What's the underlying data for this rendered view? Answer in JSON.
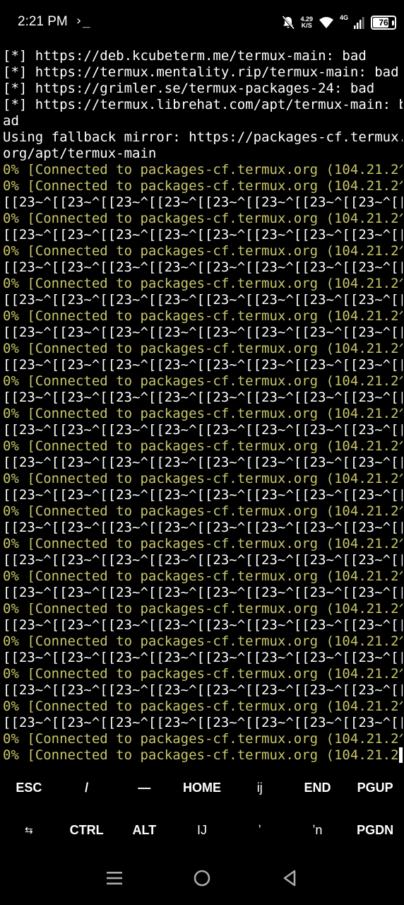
{
  "status_bar": {
    "time": "2:21 PM",
    "prompt_glyph": "›_",
    "speed_value": "4.29",
    "speed_unit": "K/S",
    "network_type": "4G",
    "battery_level": "76",
    "icons": [
      "mute-bell-icon",
      "wifi-icon",
      "signal-icon",
      "battery-icon"
    ]
  },
  "terminal": {
    "text_color": "#ffffff",
    "progress_color": "#c9c66a",
    "lines": [
      {
        "text": "[*] https://deb.kcubeterm.me/termux-main: bad",
        "color": "white"
      },
      {
        "text": "[*] https://termux.mentality.rip/termux-main: bad",
        "color": "white"
      },
      {
        "text": "[*] https://grimler.se/termux-packages-24: bad",
        "color": "white"
      },
      {
        "text": "[*] https://termux.librehat.com/apt/termux-main: b",
        "color": "white"
      },
      {
        "text": "ad",
        "color": "white"
      },
      {
        "text": "Using fallback mirror: https://packages-cf.termux.",
        "color": "white"
      },
      {
        "text": "org/apt/termux-main",
        "color": "white"
      },
      {
        "text": "0% [Connected to packages-cf.termux.org (104.21.2^",
        "color": "yellow"
      },
      {
        "text": "0% [Connected to packages-cf.termux.org (104.21.2^",
        "color": "yellow"
      },
      {
        "text": "[[23~^[[23~^[[23~^[[23~^[[23~^[[23~^[[23~^[[23~^[[",
        "color": "white"
      },
      {
        "text": "0% [Connected to packages-cf.termux.org (104.21.2^",
        "color": "yellow"
      },
      {
        "text": "[[23~^[[23~^[[23~^[[23~^[[23~^[[23~^[[23~^[[23~^[[",
        "color": "white"
      },
      {
        "text": "0% [Connected to packages-cf.termux.org (104.21.2^",
        "color": "yellow"
      },
      {
        "text": "[[23~^[[23~^[[23~^[[23~^[[23~^[[23~^[[23~^[[23~^[[",
        "color": "white"
      },
      {
        "text": "0% [Connected to packages-cf.termux.org (104.21.2^",
        "color": "yellow"
      },
      {
        "text": "[[23~^[[23~^[[23~^[[23~^[[23~^[[23~^[[23~^[[23~^[[",
        "color": "white"
      },
      {
        "text": "0% [Connected to packages-cf.termux.org (104.21.2^",
        "color": "yellow"
      },
      {
        "text": "[[23~^[[23~^[[23~^[[23~^[[23~^[[23~^[[23~^[[23~^[[",
        "color": "white"
      },
      {
        "text": "0% [Connected to packages-cf.termux.org (104.21.2^",
        "color": "yellow"
      },
      {
        "text": "[[23~^[[23~^[[23~^[[23~^[[23~^[[23~^[[23~^[[23~^[[",
        "color": "white"
      },
      {
        "text": "0% [Connected to packages-cf.termux.org (104.21.2^",
        "color": "yellow"
      },
      {
        "text": "[[23~^[[23~^[[23~^[[23~^[[23~^[[23~^[[23~^[[23~^[[",
        "color": "white"
      },
      {
        "text": "0% [Connected to packages-cf.termux.org (104.21.2^",
        "color": "yellow"
      },
      {
        "text": "[[23~^[[23~^[[23~^[[23~^[[23~^[[23~^[[23~^[[23~^[[",
        "color": "white"
      },
      {
        "text": "0% [Connected to packages-cf.termux.org (104.21.2^",
        "color": "yellow"
      },
      {
        "text": "[[23~^[[23~^[[23~^[[23~^[[23~^[[23~^[[23~^[[23~^[[",
        "color": "white"
      },
      {
        "text": "0% [Connected to packages-cf.termux.org (104.21.2^",
        "color": "yellow"
      },
      {
        "text": "[[23~^[[23~^[[23~^[[23~^[[23~^[[23~^[[23~^[[23~^[[",
        "color": "white"
      },
      {
        "text": "0% [Connected to packages-cf.termux.org (104.21.2^",
        "color": "yellow"
      },
      {
        "text": "[[23~^[[23~^[[23~^[[23~^[[23~^[[23~^[[23~^[[23~^[[",
        "color": "white"
      },
      {
        "text": "0% [Connected to packages-cf.termux.org (104.21.2^",
        "color": "yellow"
      },
      {
        "text": "[[23~^[[23~^[[23~^[[23~^[[23~^[[23~^[[23~^[[23~^[[",
        "color": "white"
      },
      {
        "text": "0% [Connected to packages-cf.termux.org (104.21.2^",
        "color": "yellow"
      },
      {
        "text": "[[23~^[[23~^[[23~^[[23~^[[23~^[[23~^[[23~^[[23~^[[",
        "color": "white"
      },
      {
        "text": "0% [Connected to packages-cf.termux.org (104.21.2^",
        "color": "yellow"
      },
      {
        "text": "[[23~^[[23~^[[23~^[[23~^[[23~^[[23~^[[23~^[[23~^[[",
        "color": "white"
      },
      {
        "text": "0% [Connected to packages-cf.termux.org (104.21.2^",
        "color": "yellow"
      },
      {
        "text": "[[23~^[[23~^[[23~^[[23~^[[23~^[[23~^[[23~^[[23~^[[",
        "color": "white"
      },
      {
        "text": "0% [Connected to packages-cf.termux.org (104.21.2^",
        "color": "yellow"
      },
      {
        "text": "[[23~^[[23~^[[23~^[[23~^[[23~^[[23~^[[23~^[[23~^[[",
        "color": "white"
      },
      {
        "text": "0% [Connected to packages-cf.termux.org (104.21.2^",
        "color": "yellow"
      },
      {
        "text": "[[23~^[[23~^[[23~^[[23~^[[23~^[[23~^[[23~^[[23~^[[",
        "color": "white"
      },
      {
        "text": "0% [Connected to packages-cf.termux.org (104.21.2^",
        "color": "yellow"
      },
      {
        "text": "0% [Connected to packages-cf.termux.org (104.21.2",
        "color": "yellow",
        "cursor": true
      }
    ]
  },
  "extra_keys": {
    "row1": [
      {
        "label": "ESC",
        "name": "esc-key"
      },
      {
        "label": "/",
        "name": "slash-key"
      },
      {
        "label": "—",
        "name": "dash-key"
      },
      {
        "label": "HOME",
        "name": "home-key"
      },
      {
        "label": "ij",
        "name": "ij-key"
      },
      {
        "label": "END",
        "name": "end-key"
      },
      {
        "label": "PGUP",
        "name": "pgup-key"
      }
    ],
    "row2": [
      {
        "label": "⇆",
        "name": "tab-key",
        "icon": "tab-arrows-icon"
      },
      {
        "label": "CTRL",
        "name": "ctrl-key"
      },
      {
        "label": "ALT",
        "name": "alt-key"
      },
      {
        "label": "IJ",
        "name": "IJ-key"
      },
      {
        "label": "ʼ",
        "name": "apostrophe-key"
      },
      {
        "label": "ʼn",
        "name": "n-apostrophe-key"
      },
      {
        "label": "PGDN",
        "name": "pgdn-key"
      }
    ]
  },
  "nav_bar": {
    "buttons": [
      "menu-icon",
      "home-circle-icon",
      "back-triangle-icon"
    ]
  }
}
